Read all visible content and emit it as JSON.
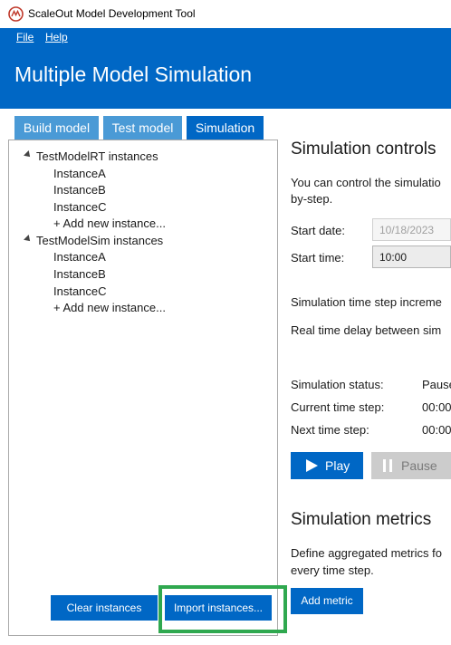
{
  "window": {
    "title": "ScaleOut Model Development Tool"
  },
  "menu": {
    "file": "File",
    "help": "Help"
  },
  "header": {
    "title": "Multiple Model Simulation"
  },
  "tabs": [
    {
      "label": "Build model",
      "active": false
    },
    {
      "label": "Test model",
      "active": false
    },
    {
      "label": "Simulation",
      "active": true
    }
  ],
  "tree": {
    "groups": [
      {
        "label": "TestModelRT instances",
        "children": [
          "InstanceA",
          "InstanceB",
          "InstanceC",
          "+ Add new instance..."
        ]
      },
      {
        "label": "TestModelSim instances",
        "children": [
          "InstanceA",
          "InstanceB",
          "InstanceC",
          "+ Add new instance..."
        ]
      }
    ]
  },
  "left_buttons": {
    "clear": "Clear instances",
    "import": "Import instances..."
  },
  "controls": {
    "heading": "Simulation controls",
    "description_line1": "You can control the simulatio",
    "description_line2": "by-step.",
    "start_date_label": "Start date:",
    "start_date_value": "10/18/2023",
    "start_time_label": "Start time:",
    "start_time_value": "10:00",
    "time_step_label": "Simulation time step increme",
    "delay_label": "Real time delay between sim",
    "status_label": "Simulation status:",
    "status_value": "Pause",
    "current_step_label": "Current time step:",
    "current_step_value": "00:00",
    "next_step_label": "Next time step:",
    "next_step_value": "00:00",
    "play": "Play",
    "pause": "Pause"
  },
  "metrics": {
    "heading": "Simulation metrics",
    "description_line1": "Define aggregated metrics fo",
    "description_line2": "every time step.",
    "add_metric": "Add metric"
  },
  "colors": {
    "accent": "#0067c5",
    "tab_inactive": "#4a9ad6",
    "highlight": "#2fa84f"
  },
  "icons": {
    "app": "app-logo-icon",
    "expand": "caret-expanded-icon",
    "play": "play-icon",
    "pause": "pause-icon"
  }
}
